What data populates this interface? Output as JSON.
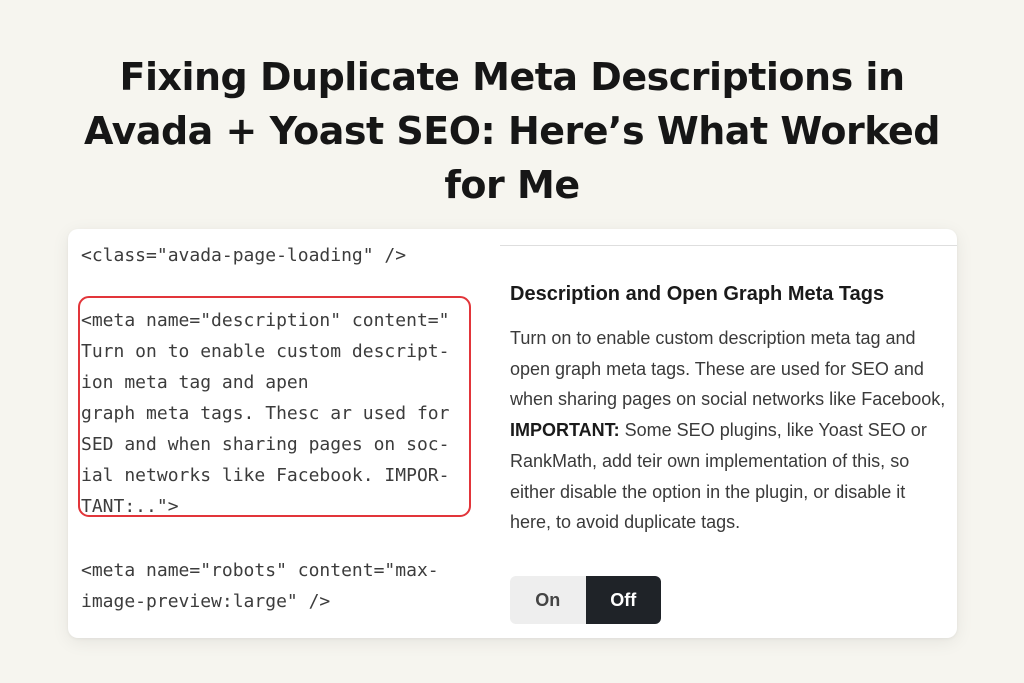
{
  "article": {
    "title": "Fixing Duplicate Meta Descriptions in Avada + Yoast SEO: Here’s What Worked for Me"
  },
  "code_panel": {
    "loading_tag": "<class=\"avada-page-loading\" />",
    "description_tag": "<meta name=\"description\" content=\"\nTurn on to enable custom descript-\nion meta tag and apen\ngraph meta tags. Thesc ar used for\nSED and when sharing pages on soc-\nial networks like Facebook. IMPOR-\nTANT:..\">",
    "robots_tag": "<meta name=\"robots\" content=\"max-\nimage-preview:large\" />",
    "highlight_color": "#e2353a"
  },
  "option_panel": {
    "heading": "Description and Open Graph Meta Tags",
    "description_before": "Turn on to enable custom description meta tag and open graph meta tags. These are used for SEO and when sharing pages on social networks like Facebook, ",
    "description_important": "IMPORTANT:",
    "description_after": " Some SEO plugins, like Yoast SEO or RankMath, add teir own implementation of this, so either disable the option in the plugin, or disable it here, to avoid duplicate tags.",
    "toggle": {
      "on_label": "On",
      "off_label": "Off",
      "selected": "Off",
      "selected_color": "#1f2328"
    }
  }
}
